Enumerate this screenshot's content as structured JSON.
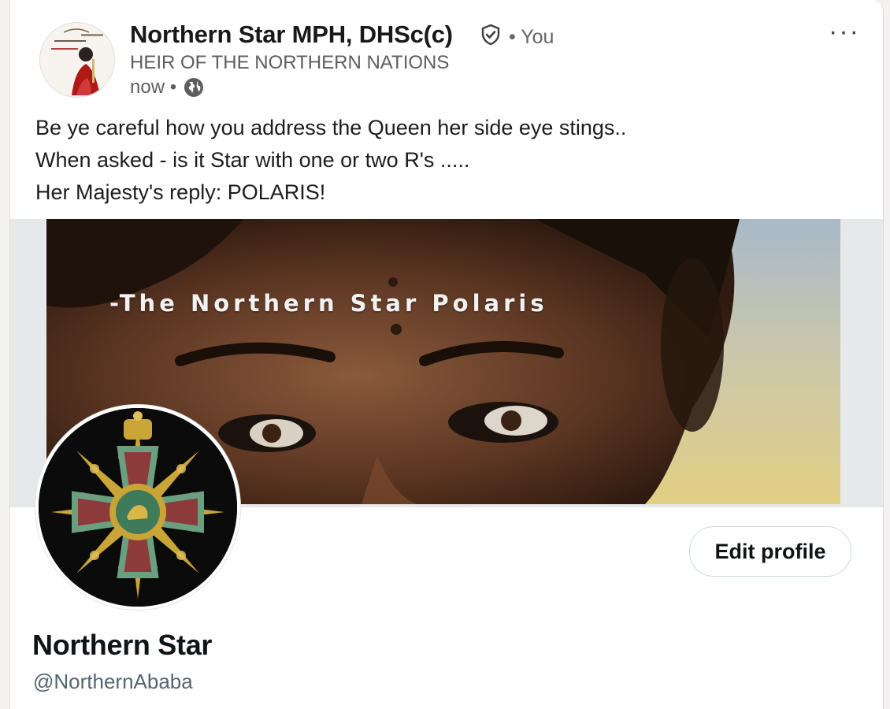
{
  "post": {
    "author_name": "Northern Star MPH, DHSc(c)",
    "you_label": "• You",
    "headline": "HEIR OF THE NORTHERN NATIONS",
    "timestamp": "now •",
    "more_label": "···",
    "text_lines": [
      "Be ye careful how you address the Queen her side eye stings..",
      "When asked - is it Star with one or two R's .....",
      "Her Majesty's reply: POLARIS!"
    ],
    "avatar_icon": "author-avatar-illustration",
    "verified_icon": "shield-check-icon",
    "visibility_icon": "globe-icon"
  },
  "embedded_profile": {
    "banner_caption": "-The Northern Star Polaris",
    "edit_button_label": "Edit profile",
    "display_name": "Northern Star",
    "handle": "@NorthernAbaba",
    "avatar_icon": "medal-emblem"
  },
  "colors": {
    "background": "#f3f2ef",
    "card": "#ffffff",
    "muted_text": "#5e5e5e",
    "handle_text": "#536471"
  }
}
